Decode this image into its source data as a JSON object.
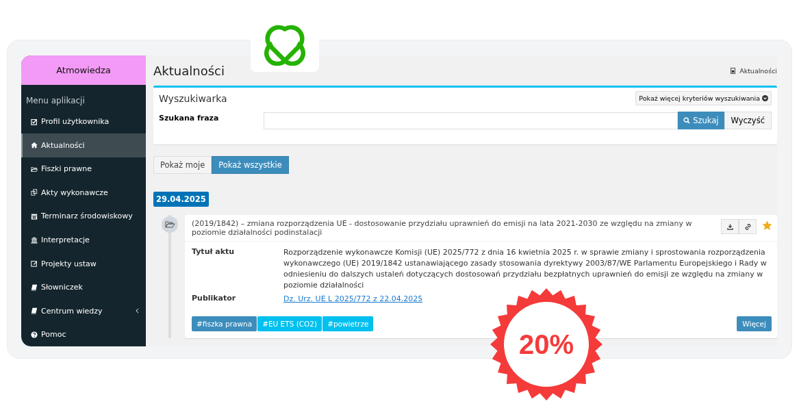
{
  "brand": {
    "name": "Atmowiedza"
  },
  "sidebar": {
    "heading": "Menu aplikacji",
    "items": [
      {
        "label": "Profil użytkownika",
        "selected": false,
        "expandable": false
      },
      {
        "label": "Aktualności",
        "selected": true,
        "expandable": false
      },
      {
        "label": "Fiszki prawne",
        "selected": false,
        "expandable": false
      },
      {
        "label": "Akty wykonawcze",
        "selected": false,
        "expandable": false
      },
      {
        "label": "Terminarz środowiskowy",
        "selected": false,
        "expandable": false
      },
      {
        "label": "Interpretacje",
        "selected": false,
        "expandable": false
      },
      {
        "label": "Projekty ustaw",
        "selected": false,
        "expandable": false
      },
      {
        "label": "Słowniczek",
        "selected": false,
        "expandable": false
      },
      {
        "label": "Centrum wiedzy",
        "selected": false,
        "expandable": true
      },
      {
        "label": "Pomoc",
        "selected": false,
        "expandable": false
      }
    ]
  },
  "page": {
    "title": "Aktualności",
    "breadcrumb": "Aktualności"
  },
  "search": {
    "title": "Wyszukiwarka",
    "more_button": "Pokaż więcej kryteriów wyszukiwania",
    "field_label": "Szukana fraza",
    "search_button": "Szukaj",
    "clear_button": "Wyczyść"
  },
  "filters": [
    {
      "label": "Pokaż moje",
      "selected": false
    },
    {
      "label": "Pokaż wszystkie",
      "selected": true
    }
  ],
  "timeline": {
    "date": "29.04.2025",
    "entries": [
      {
        "title": "(2019/1842) – zmiana rozporządzenia UE - dostosowanie przydziału uprawnień do emisji na lata 2021-2030 ze względu na zmiany w poziomie działalności podinstalacji",
        "starred": true,
        "details": [
          {
            "label": "Tytuł aktu",
            "value": "Rozporządzenie wykonawcze Komisji (UE) 2025/772 z dnia 16 kwietnia 2025 r. w sprawie zmiany i sprostowania rozporządzenia wykonawczego (UE) 2019/1842 ustanawiającego zasady stosowania dyrektywy 2003/87/WE Parlamentu Europejskiego i Rady w odniesieniu do dalszych ustaleń dotyczących dostosowań przydziału bezpłatnych uprawnień do emisji ze względu na zmiany w poziomie działalności",
            "kind": "text"
          },
          {
            "label": "Publikator",
            "value": "Dz. Urz. UE L 2025/772 z 22.04.2025",
            "kind": "link"
          }
        ],
        "tags": [
          {
            "label": "#fiszka prawna",
            "color": "#3c8dbc"
          },
          {
            "label": "#EU ETS (CO2)",
            "color": "#00c0ef"
          },
          {
            "label": "#powietrze",
            "color": "#00c0ef"
          }
        ],
        "more_button": "Więcej"
      }
    ]
  },
  "badge": {
    "text": "20%"
  }
}
